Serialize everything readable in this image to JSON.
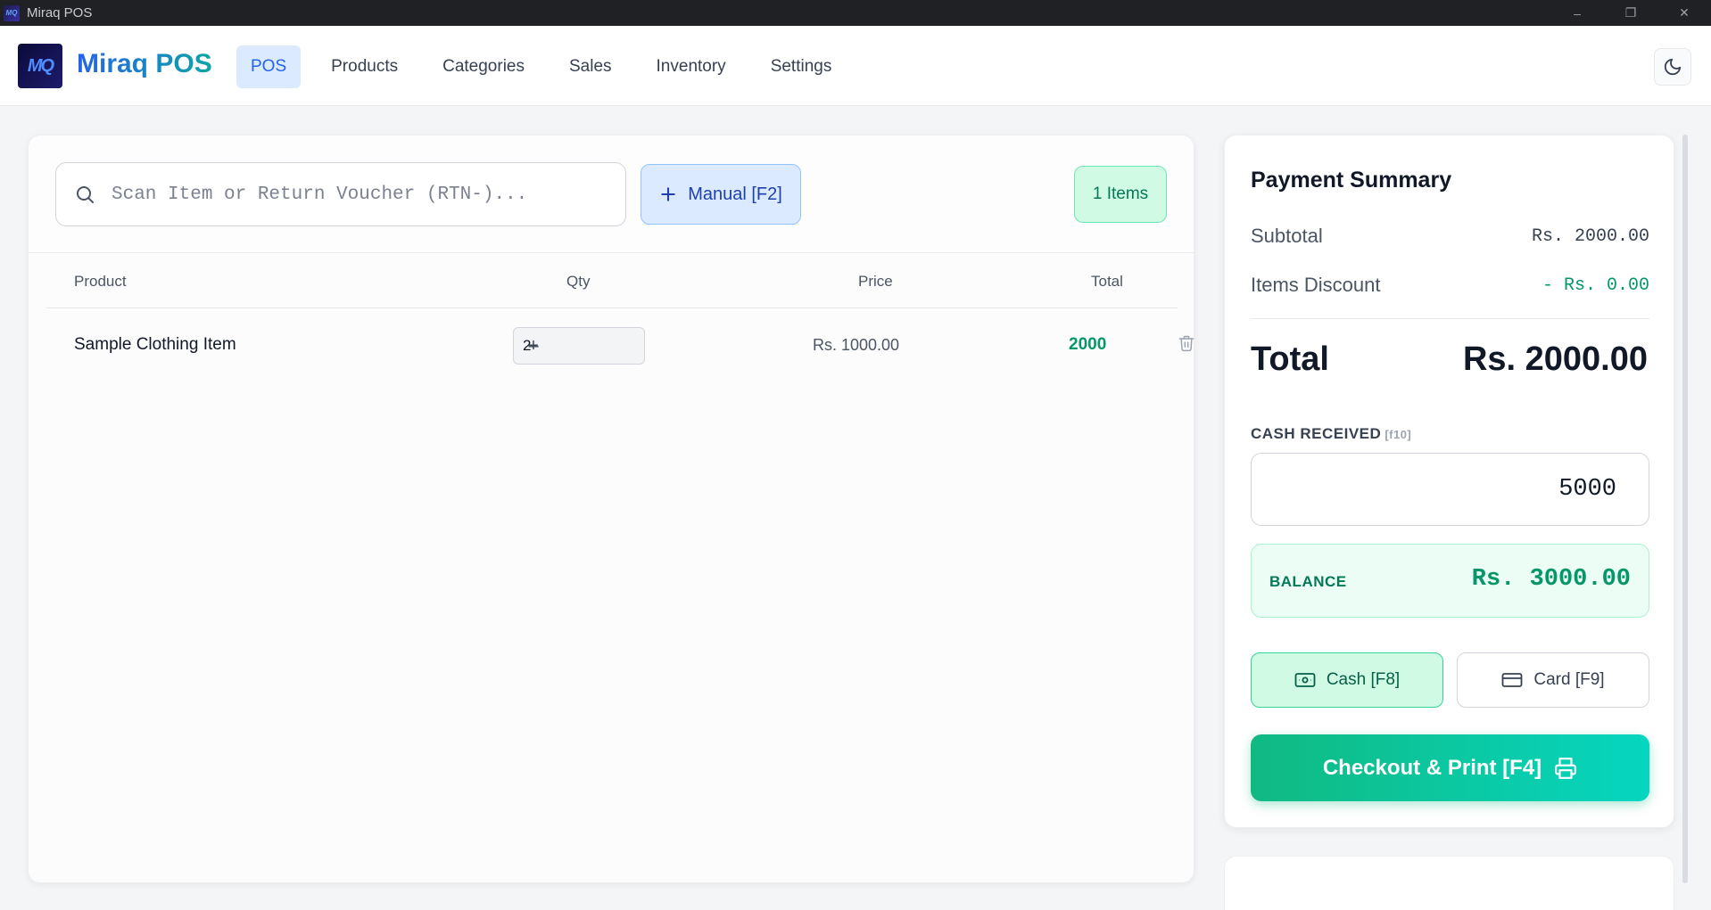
{
  "window": {
    "title": "Miraq POS",
    "icon_text": "MQ",
    "minimize": "–",
    "maximize": "❐",
    "close": "✕"
  },
  "nav": {
    "logo_text": "MQ",
    "brand": "Miraq POS",
    "items": [
      {
        "label": "POS",
        "active": true
      },
      {
        "label": "Products"
      },
      {
        "label": "Categories"
      },
      {
        "label": "Sales"
      },
      {
        "label": "Inventory"
      },
      {
        "label": "Settings"
      }
    ],
    "theme_icon": "moon-icon"
  },
  "cart": {
    "search_placeholder": "Scan Item or Return Voucher (RTN-)...",
    "manual_label": "Manual [F2]",
    "items_badge": "1 Items",
    "columns": {
      "product": "Product",
      "qty": "Qty",
      "price": "Price",
      "total": "Total"
    },
    "rows": [
      {
        "product": "Sample Clothing Item",
        "qty": "2",
        "price": "Rs. 1000.00",
        "total": "2000"
      }
    ]
  },
  "payment": {
    "title": "Payment Summary",
    "subtotal_label": "Subtotal",
    "subtotal_value": "Rs. 2000.00",
    "discount_label": "Items Discount",
    "discount_value": "- Rs. 0.00",
    "total_label": "Total",
    "total_value": "Rs. 2000.00",
    "cash_label": "CASH RECEIVED",
    "cash_hint": "[f10]",
    "cash_value": "5000",
    "balance_label": "BALANCE",
    "balance_value": "Rs. 3000.00",
    "cash_button": "Cash [F8]",
    "card_button": "Card [F9]",
    "checkout_button": "Checkout & Print [F4]"
  },
  "colors": {
    "accent_blue": "#2563eb",
    "accent_green": "#10b981",
    "total_green": "#059669"
  }
}
